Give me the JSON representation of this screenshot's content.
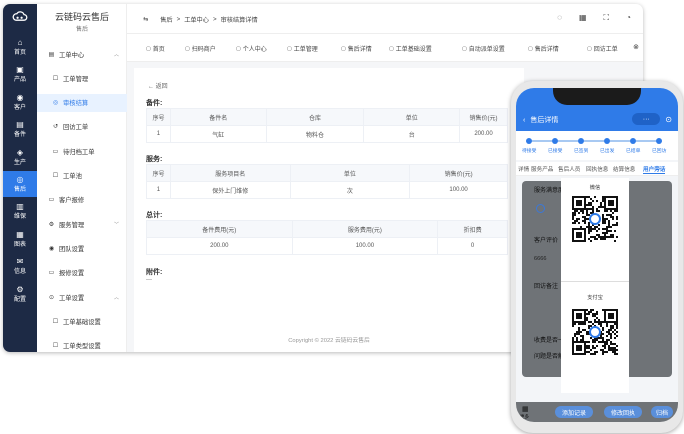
{
  "brand": {
    "title": "云链码云售后",
    "subtitle": "售后"
  },
  "rail": [
    {
      "icon": "home-icon",
      "glyph": "⌂",
      "label": "首页"
    },
    {
      "icon": "product-icon",
      "glyph": "▣",
      "label": "产品"
    },
    {
      "icon": "customer-icon",
      "glyph": "◉",
      "label": "客户"
    },
    {
      "icon": "parts-icon",
      "glyph": "▤",
      "label": "备件"
    },
    {
      "icon": "production-icon",
      "glyph": "◈",
      "label": "生产"
    },
    {
      "icon": "after-sales-icon",
      "glyph": "◎",
      "label": "售后"
    },
    {
      "icon": "maintenance-icon",
      "glyph": "▥",
      "label": "维保"
    },
    {
      "icon": "chart-icon",
      "glyph": "▦",
      "label": "图表"
    },
    {
      "icon": "message-icon",
      "glyph": "✉",
      "label": "信息"
    },
    {
      "icon": "config-icon",
      "glyph": "⚙",
      "label": "配置"
    }
  ],
  "side": [
    {
      "label": "工单中心",
      "glyph": "▤",
      "chev": "︿"
    },
    {
      "label": "工单管理",
      "glyph": "☐"
    },
    {
      "label": "审核结算",
      "glyph": "◎"
    },
    {
      "label": "回访工单",
      "glyph": "↺"
    },
    {
      "label": "待归档工单",
      "glyph": "▭"
    },
    {
      "label": "工单池",
      "glyph": "☐"
    },
    {
      "label": "客户报修",
      "glyph": "▭"
    },
    {
      "label": "服务管理",
      "glyph": "⚙",
      "chev": "﹀"
    },
    {
      "label": "团队设置",
      "glyph": "◉"
    },
    {
      "label": "报修设置",
      "glyph": "▭"
    },
    {
      "label": "工单设置",
      "glyph": "⊙",
      "chev": "︿"
    },
    {
      "label": "工单基础设置",
      "glyph": "☐"
    },
    {
      "label": "工单类型设置",
      "glyph": "☐"
    }
  ],
  "breadcrumb": {
    "menu_glyph": "⇆",
    "items": [
      "售后",
      ">",
      "工单中心",
      ">",
      "审核结算详情"
    ]
  },
  "tabs": [
    "首页",
    "扫码商户",
    "个人中心",
    "工单管理",
    "售后详情",
    "工单基础设置",
    "自动派单设置",
    "售后详情",
    "回访工单"
  ],
  "back": "← 返回",
  "parts": {
    "title": "备件:",
    "headers": [
      "序号",
      "备件名",
      "仓库",
      "单位",
      "销售价(元)"
    ],
    "rows": [
      [
        "1",
        "气缸",
        "物料仓",
        "台",
        "200.00"
      ]
    ]
  },
  "service": {
    "title": "服务:",
    "headers": [
      "序号",
      "服务项目名",
      "单位",
      "销售价(元)"
    ],
    "rows": [
      [
        "1",
        "保外上门维修",
        "次",
        "100.00"
      ]
    ]
  },
  "total": {
    "title": "总计:",
    "headers": [
      "备件费用(元)",
      "服务费用(元)",
      "折扣费"
    ],
    "rows": [
      [
        "200.00",
        "100.00",
        "0"
      ]
    ]
  },
  "attach": {
    "title": "附件:",
    "value": "—"
  },
  "footer": "Copyright © 2022 云链码云售后",
  "mobile": {
    "title": "售后详情",
    "capsule_dots": "···",
    "steps": [
      "待接受",
      "已接受",
      "已签到",
      "已出发",
      "已结单",
      "已回访"
    ],
    "tabs": [
      "详情",
      "服务产品",
      "售后人员",
      "回执信息",
      "结算信息",
      "用户旁话"
    ],
    "labels": {
      "service_satisfaction": "服务满意度",
      "customer_eval": "客户评价",
      "eval_value": "6666",
      "remark": "回访备注",
      "q1": "收费是否一致",
      "q2": "问题是否解决"
    },
    "qr": {
      "wechat": "微信",
      "alipay": "支付宝"
    },
    "buttons": [
      "添加记录",
      "修改回执",
      "归档"
    ],
    "more": "更多"
  }
}
